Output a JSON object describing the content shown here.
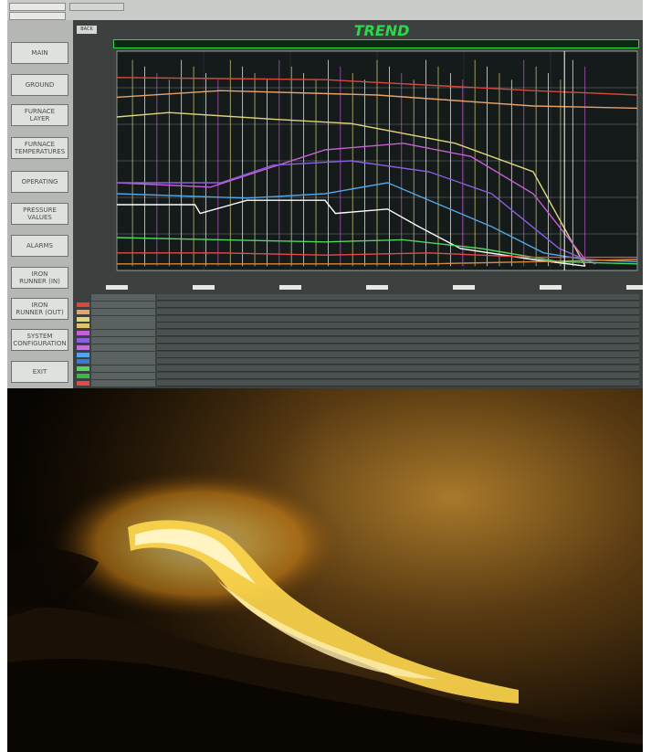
{
  "topbar": {
    "field_1": "",
    "field_2": ""
  },
  "back_label": "BACK",
  "trend_title": "TREND",
  "sidebar": {
    "items": [
      {
        "label": "MAIN"
      },
      {
        "label": "GROUND"
      },
      {
        "label": "FURNACE\nLAYER"
      },
      {
        "label": "FURNACE\nTEMPERATURES"
      },
      {
        "label": "OPERATING"
      },
      {
        "label": "PRESSURE\nVALUES"
      },
      {
        "label": "ALARMS"
      },
      {
        "label": "IRON\nRUNNER (IN)"
      },
      {
        "label": "IRON\nRUNNER (OUT)"
      },
      {
        "label": "SYSTEM\nCONFIGURATION"
      },
      {
        "label": "EXIT"
      }
    ]
  },
  "colors": {
    "accent_green": "#2bd84a",
    "screen_bg": "#3c4140"
  },
  "chart_data": {
    "type": "line",
    "title": "",
    "y_ticks": [
      "",
      "",
      "",
      "",
      "",
      "",
      ""
    ],
    "x_ticks": [
      {
        "time": "",
        "date": ""
      },
      {
        "time": "",
        "date": ""
      },
      {
        "time": "",
        "date": ""
      },
      {
        "time": "",
        "date": ""
      },
      {
        "time": "",
        "date": ""
      },
      {
        "time": "",
        "date": ""
      },
      {
        "time": "",
        "date": ""
      }
    ],
    "ylim": [
      0,
      100
    ],
    "xlim": [
      0,
      100
    ],
    "series": [
      {
        "color": "#d64a3a",
        "x": [
          0,
          40,
          80,
          100
        ],
        "y": [
          88,
          87,
          82,
          80
        ]
      },
      {
        "color": "#e8a36a",
        "x": [
          0,
          20,
          50,
          80,
          100
        ],
        "y": [
          79,
          82,
          80,
          75,
          74
        ]
      },
      {
        "color": "#ddd67a",
        "x": [
          0,
          10,
          30,
          45,
          65,
          80,
          90
        ],
        "y": [
          70,
          72,
          69,
          67,
          58,
          45,
          2
        ]
      },
      {
        "color": "#c75fd6",
        "x": [
          0,
          18,
          40,
          55,
          68,
          80,
          90
        ],
        "y": [
          40,
          38,
          55,
          58,
          52,
          35,
          5
        ]
      },
      {
        "color": "#8a5fe0",
        "x": [
          0,
          20,
          30,
          45,
          60,
          72,
          85,
          92
        ],
        "y": [
          40,
          40,
          48,
          50,
          45,
          35,
          10,
          3
        ]
      },
      {
        "color": "#4fa6e8",
        "x": [
          0,
          25,
          40,
          52,
          62,
          72,
          82,
          90,
          100
        ],
        "y": [
          35,
          33,
          35,
          40,
          30,
          20,
          8,
          5,
          4
        ]
      },
      {
        "color": "#ffffff",
        "x": [
          0,
          15,
          16,
          25,
          40,
          42,
          52,
          58,
          66,
          80,
          90
        ],
        "y": [
          30,
          30,
          26,
          32,
          32,
          26,
          28,
          20,
          10,
          5,
          2
        ]
      },
      {
        "color": "#4fd660",
        "x": [
          0,
          20,
          40,
          55,
          70,
          85,
          100
        ],
        "y": [
          15,
          14,
          13,
          14,
          10,
          4,
          3
        ]
      },
      {
        "color": "#e84848",
        "x": [
          0,
          20,
          40,
          60,
          80,
          100
        ],
        "y": [
          8,
          8,
          7,
          8,
          6,
          6
        ]
      },
      {
        "color": "#d38a3a",
        "x": [
          0,
          30,
          60,
          80,
          100
        ],
        "y": [
          3,
          3,
          3,
          4,
          5
        ]
      }
    ],
    "legend_header": {
      "name": "",
      "value": ""
    },
    "legend": [
      {
        "color": "#d64a3a",
        "name": "",
        "value": ""
      },
      {
        "color": "#e8a36a",
        "name": "",
        "value": ""
      },
      {
        "color": "#ddd67a",
        "name": "",
        "value": ""
      },
      {
        "color": "#e0c26a",
        "name": "",
        "value": ""
      },
      {
        "color": "#c75fd6",
        "name": "",
        "value": ""
      },
      {
        "color": "#8a5fe0",
        "name": "",
        "value": ""
      },
      {
        "color": "#c070d8",
        "name": "",
        "value": ""
      },
      {
        "color": "#4fa6e8",
        "name": "",
        "value": ""
      },
      {
        "color": "#3a7ad6",
        "name": "",
        "value": ""
      },
      {
        "color": "#4fd660",
        "name": "",
        "value": ""
      },
      {
        "color": "#3ab84a",
        "name": "",
        "value": ""
      },
      {
        "color": "#e84848",
        "name": "",
        "value": ""
      }
    ]
  }
}
